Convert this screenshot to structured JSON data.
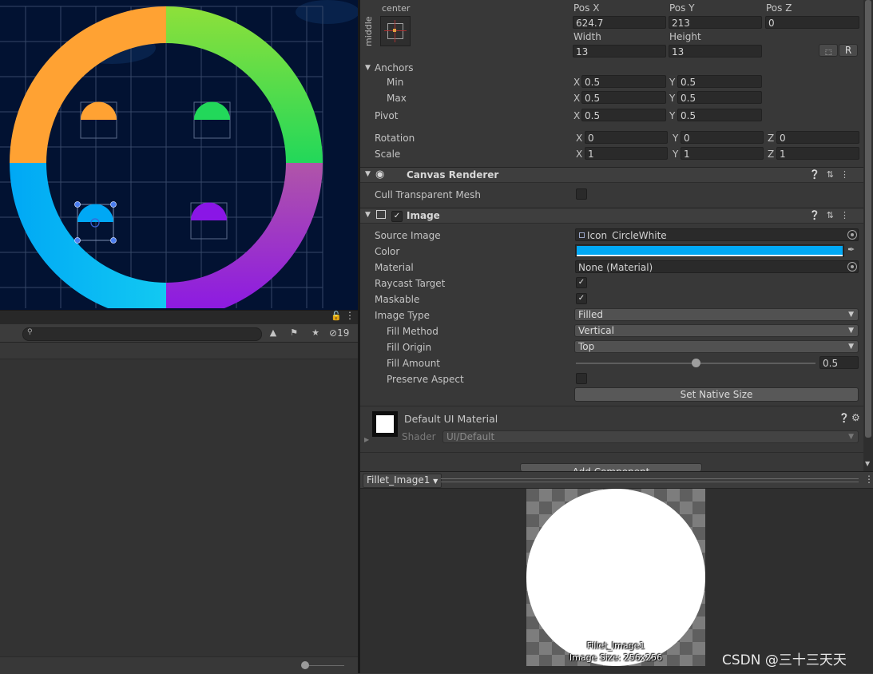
{
  "scene": {
    "colors": {
      "orange": "#ffa233",
      "green_top": "#8ee03a",
      "green": "#22d85a",
      "purple_top": "#b055a8",
      "purple": "#8a16e6",
      "blue": "#00a8f5",
      "cyan": "#12c9f2",
      "background": "#021232"
    }
  },
  "project": {
    "lock_icon": "lock-icon",
    "hidden_count": "19"
  },
  "rect_transform": {
    "anchor_preset_top": "center",
    "anchor_preset_side": "middle",
    "pos_x_label": "Pos X",
    "pos_x": "624.7",
    "pos_y_label": "Pos Y",
    "pos_y": "213",
    "pos_z_label": "Pos Z",
    "pos_z": "0",
    "width_label": "Width",
    "width": "13",
    "height_label": "Height",
    "height": "13",
    "r_button": "R",
    "anchors_label": "Anchors",
    "min_label": "Min",
    "min_x": "0.5",
    "min_y": "0.5",
    "max_label": "Max",
    "max_x": "0.5",
    "max_y": "0.5",
    "pivot_label": "Pivot",
    "pivot_x": "0.5",
    "pivot_y": "0.5",
    "rotation_label": "Rotation",
    "rot_x": "0",
    "rot_y": "0",
    "rot_z": "0",
    "scale_label": "Scale",
    "scale_x": "1",
    "scale_y": "1",
    "scale_z": "1",
    "x": "X",
    "y": "Y",
    "z": "Z"
  },
  "canvas_renderer": {
    "title": "Canvas Renderer",
    "cull_label": "Cull Transparent Mesh"
  },
  "image": {
    "title": "Image",
    "source_label": "Source Image",
    "source_value": "Icon_CircleWhite",
    "color_label": "Color",
    "color_value": "#00a8f5",
    "material_label": "Material",
    "material_value": "None (Material)",
    "raycast_label": "Raycast Target",
    "raycast_checked": "✓",
    "maskable_label": "Maskable",
    "maskable_checked": "✓",
    "type_label": "Image Type",
    "type_value": "Filled",
    "fill_method_label": "Fill Method",
    "fill_method_value": "Vertical",
    "fill_origin_label": "Fill Origin",
    "fill_origin_value": "Top",
    "fill_amount_label": "Fill Amount",
    "fill_amount_value": "0.5",
    "fill_amount_fraction": 0.5,
    "preserve_label": "Preserve Aspect",
    "native_size_button": "Set Native Size"
  },
  "material": {
    "name": "Default UI Material",
    "shader_label": "Shader",
    "shader_value": "UI/Default"
  },
  "add_component_label": "Add Component",
  "preview": {
    "object_name": "Fillet_Image1",
    "caption_name": "Fillet_Image1",
    "caption_size": "Image Size: 256x256"
  },
  "watermark": "CSDN @三十三天天"
}
